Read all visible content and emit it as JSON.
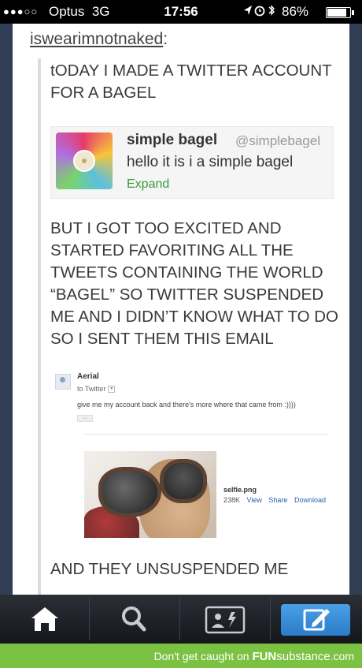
{
  "status_bar": {
    "signal_dots": "●●●○○",
    "carrier": "Optus",
    "network": "3G",
    "time": "17:56",
    "battery": "86%"
  },
  "post": {
    "username": "iswearimnotnaked",
    "username_suffix": ":",
    "text_1": "tODAY I MADE A TWITTER ACCOUNT FOR A BAGEL",
    "text_2": "BUT I GOT TOO EXCITED AND STARTED FAVORITING ALL THE TWEETS CONTAINING THE WORLD “BAGEL” SO TWITTER SUSPENDED ME AND I DIDN’T KNOW WHAT TO DO SO I SENT THEM THIS EMAIL",
    "text_3": "AND THEY UNSUSPENDED ME"
  },
  "tweet": {
    "display_name": "simple bagel",
    "handle": "@simplebagel",
    "text": "hello it is i a simple bagel",
    "expand": "Expand"
  },
  "email": {
    "from": "Aerial",
    "to": "to Twitter",
    "body": "give me my account back and there's more where that came from :))))",
    "more": "..."
  },
  "attachment": {
    "filename": "selfie.png",
    "size": "238K",
    "view": "View",
    "share": "Share",
    "download": "Download"
  },
  "tabbar": {
    "items": [
      "home-icon",
      "search-icon",
      "camera-icon",
      "compose-icon"
    ],
    "active_color": "#3d8fd8"
  },
  "footer": {
    "text": "Don't get caught on",
    "brand_bold": "FUN",
    "brand_rest": "substance",
    "brand_suffix": ".com",
    "color": "#7bc142"
  }
}
